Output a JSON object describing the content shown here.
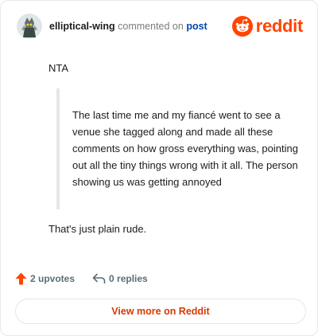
{
  "header": {
    "username": "elliptical-wing",
    "verb": "commented on",
    "post_link": "post",
    "brand": "reddit"
  },
  "comment": {
    "opening": "NTA",
    "quote": "The last time me and my fiancé went to see a venue she tagged along and made all these comments on how gross everything was, pointing out all the tiny things wrong with it all. The person showing us was getting annoyed",
    "reply": "That's just plain rude."
  },
  "actions": {
    "upvotes": "2 upvotes",
    "replies": "0 replies"
  },
  "footer": {
    "view_more": "View more on Reddit"
  },
  "colors": {
    "brand": "#ff4500",
    "link": "#0045ac",
    "cta": "#d93a00"
  },
  "icons": [
    "avatar",
    "reddit-snoo-icon",
    "upvote-arrow-icon",
    "reply-arrow-icon"
  ]
}
